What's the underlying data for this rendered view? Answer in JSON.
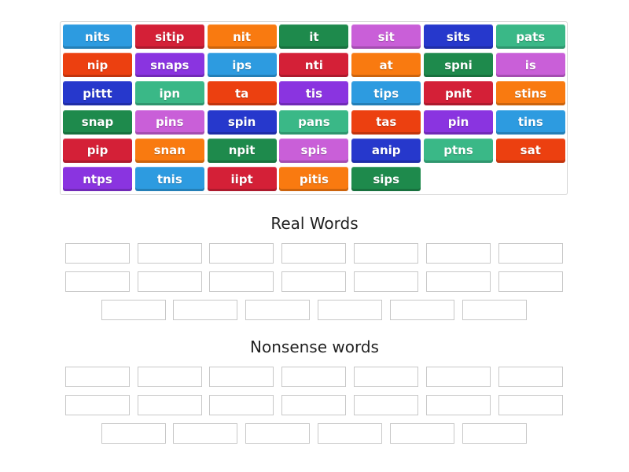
{
  "colors": {
    "blue_light": "#2d9be0",
    "red": "#d42037",
    "orange": "#f97a10",
    "green_dark": "#1e8a4c",
    "violet": "#c95fd8",
    "blue_dark": "#2638cc",
    "green_light": "#3ab887",
    "red_orange": "#ec4010",
    "purple": "#8a34e0"
  },
  "tiles": [
    {
      "label": "nits",
      "color": "#2d9be0"
    },
    {
      "label": "sitip",
      "color": "#d42037"
    },
    {
      "label": "nit",
      "color": "#f97a10"
    },
    {
      "label": "it",
      "color": "#1e8a4c"
    },
    {
      "label": "sit",
      "color": "#c95fd8"
    },
    {
      "label": "sits",
      "color": "#2638cc"
    },
    {
      "label": "pats",
      "color": "#3ab887"
    },
    {
      "label": "nip",
      "color": "#ec4010"
    },
    {
      "label": "snaps",
      "color": "#8a34e0"
    },
    {
      "label": "ips",
      "color": "#2d9be0"
    },
    {
      "label": "nti",
      "color": "#d42037"
    },
    {
      "label": "at",
      "color": "#f97a10"
    },
    {
      "label": "spni",
      "color": "#1e8a4c"
    },
    {
      "label": "is",
      "color": "#c95fd8"
    },
    {
      "label": "pittt",
      "color": "#2638cc"
    },
    {
      "label": "ipn",
      "color": "#3ab887"
    },
    {
      "label": "ta",
      "color": "#ec4010"
    },
    {
      "label": "tis",
      "color": "#8a34e0"
    },
    {
      "label": "tips",
      "color": "#2d9be0"
    },
    {
      "label": "pnit",
      "color": "#d42037"
    },
    {
      "label": "stins",
      "color": "#f97a10"
    },
    {
      "label": "snap",
      "color": "#1e8a4c"
    },
    {
      "label": "pins",
      "color": "#c95fd8"
    },
    {
      "label": "spin",
      "color": "#2638cc"
    },
    {
      "label": "pans",
      "color": "#3ab887"
    },
    {
      "label": "tas",
      "color": "#ec4010"
    },
    {
      "label": "pin",
      "color": "#8a34e0"
    },
    {
      "label": "tins",
      "color": "#2d9be0"
    },
    {
      "label": "pip",
      "color": "#d42037"
    },
    {
      "label": "snan",
      "color": "#f97a10"
    },
    {
      "label": "npit",
      "color": "#1e8a4c"
    },
    {
      "label": "spis",
      "color": "#c95fd8"
    },
    {
      "label": "anip",
      "color": "#2638cc"
    },
    {
      "label": "ptns",
      "color": "#3ab887"
    },
    {
      "label": "sat",
      "color": "#ec4010"
    },
    {
      "label": "ntps",
      "color": "#8a34e0"
    },
    {
      "label": "tnis",
      "color": "#2d9be0"
    },
    {
      "label": "iipt",
      "color": "#d42037"
    },
    {
      "label": "pitis",
      "color": "#f97a10"
    },
    {
      "label": "sips",
      "color": "#1e8a4c"
    }
  ],
  "groups": [
    {
      "title": "Real Words",
      "slot_count": 20
    },
    {
      "title": "Nonsense words",
      "slot_count": 20
    }
  ]
}
